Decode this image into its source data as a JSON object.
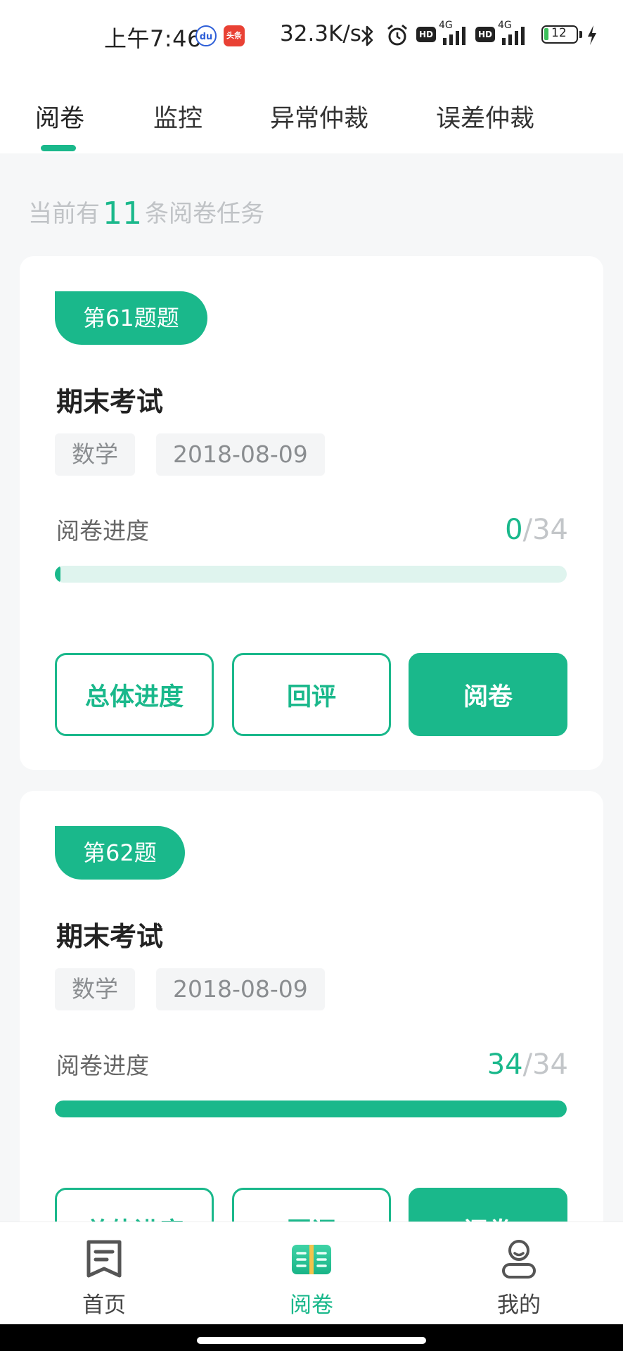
{
  "status_bar": {
    "time": "上午7:46",
    "net_speed": "32.3K/s",
    "battery": "12",
    "network_1": "4G",
    "network_2": "4G",
    "hd_1": "HD",
    "hd_2": "HD",
    "toutiao_text": "头条"
  },
  "tabs": [
    {
      "label": "阅卷",
      "active": true
    },
    {
      "label": "监控",
      "active": false
    },
    {
      "label": "异常仲裁",
      "active": false
    },
    {
      "label": "误差仲裁",
      "active": false
    }
  ],
  "task_summary": {
    "prefix": "当前有",
    "count": "11",
    "suffix": "条阅卷任务"
  },
  "tasks": [
    {
      "badge": "第61题题",
      "title": "期末考试",
      "subject": "数学",
      "date": "2018-08-09",
      "progress_label": "阅卷进度",
      "done": "0",
      "sep": "/",
      "total": "34",
      "progress_fraction": 0.0,
      "buttons": [
        "总体进度",
        "回评",
        "阅卷"
      ]
    },
    {
      "badge": "第62题",
      "title": "期末考试",
      "subject": "数学",
      "date": "2018-08-09",
      "progress_label": "阅卷进度",
      "done": "34",
      "sep": "/",
      "total": "34",
      "progress_fraction": 1.0,
      "buttons": [
        "总体进度",
        "回评",
        "阅卷"
      ]
    }
  ],
  "bottom_nav": [
    {
      "label": "首页",
      "icon": "home-book-icon",
      "active": false
    },
    {
      "label": "阅卷",
      "icon": "open-book-icon",
      "active": true
    },
    {
      "label": "我的",
      "icon": "person-icon",
      "active": false
    }
  ],
  "colors": {
    "accent": "#1ab88b",
    "track": "#dff4ee",
    "background": "#f6f7f8"
  }
}
